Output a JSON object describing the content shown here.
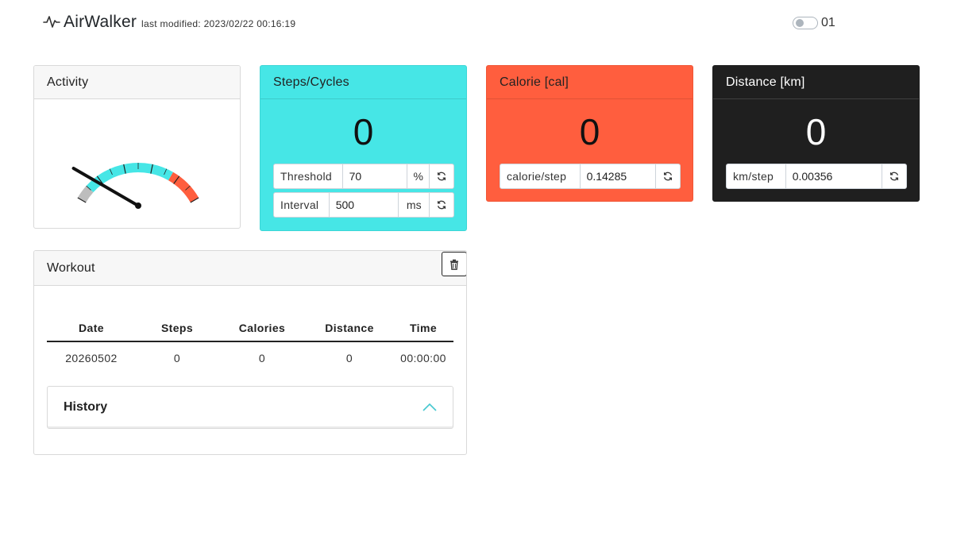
{
  "app": {
    "title": "AirWalker",
    "modified": "last modified: 2023/02/22 00:16:19",
    "toggle_label": "01",
    "toggle_on": false
  },
  "activity": {
    "title": "Activity",
    "gauge_level": 0
  },
  "steps": {
    "title": "Steps/Cycles",
    "value": "0",
    "threshold": {
      "label": "Threshold",
      "value": "70",
      "unit": "%"
    },
    "interval": {
      "label": "Interval",
      "value": "500",
      "unit": "ms"
    }
  },
  "calorie": {
    "title": "Calorie [cal]",
    "value": "0",
    "per_step": {
      "label": "calorie/step",
      "value": "0.14285"
    }
  },
  "distance": {
    "title": "Distance [km]",
    "value": "0",
    "per_step": {
      "label": "km/step",
      "value": "0.00356"
    }
  },
  "workout": {
    "title": "Workout",
    "columns": [
      "Date",
      "Steps",
      "Calories",
      "Distance",
      "Time"
    ],
    "rows": [
      [
        "20260502",
        "0",
        "0",
        "0",
        "00:00:00"
      ]
    ],
    "history_label": "History"
  },
  "colors": {
    "cyan": "#46e6e6",
    "orange": "#ff5e3e",
    "dark": "#1f1f1f",
    "gray": "#bdbdbd"
  }
}
